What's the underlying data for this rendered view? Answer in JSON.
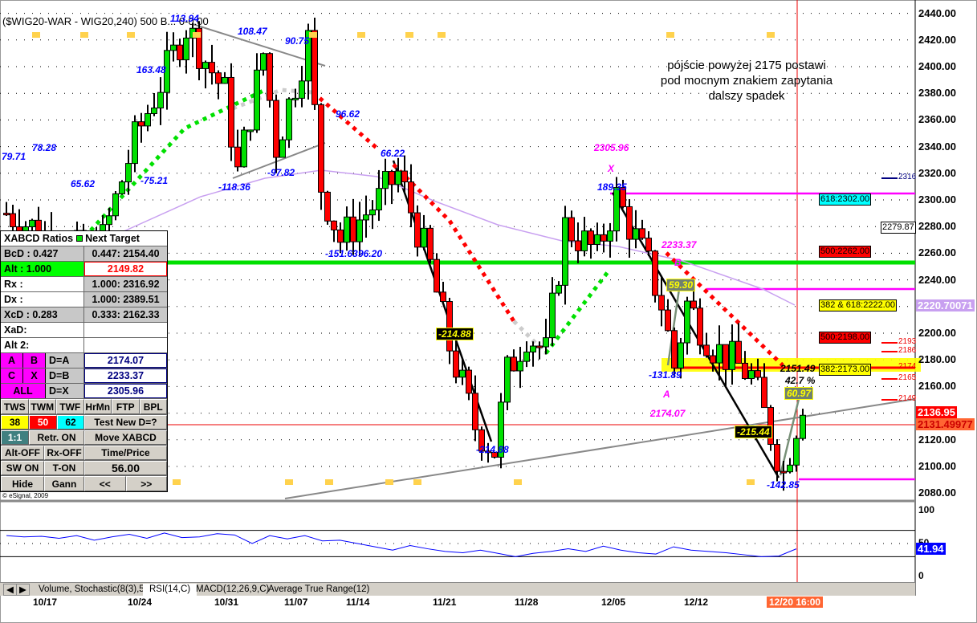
{
  "header": {
    "title": "($WIG20-WAR - WIG20,240) 500 B... 0-0:00",
    "copyright": "© eSignal, 2009"
  },
  "note": "pójście powyżej 2175 postawi pod mocnym znakiem zapytania dalszy spadek",
  "chart_data": {
    "type": "candlestick",
    "title": "($WIG20-WAR - WIG20,240)",
    "ylim": [
      2080,
      2440
    ],
    "y_ticks": [
      "2440.00",
      "2420.00",
      "2400.00",
      "2380.00",
      "2360.00",
      "2340.00",
      "2320.00",
      "2300.00",
      "2280.00",
      "2260.00",
      "2240.00",
      "2220.00",
      "2200.00",
      "2180.00",
      "2160.00",
      "2140.00",
      "2120.00",
      "2100.00",
      "2080.00"
    ],
    "x_ticks": [
      "10/17",
      "10/24",
      "10/31",
      "11/07",
      "11/14",
      "11/21",
      "11/28",
      "12/05",
      "12/12"
    ],
    "current_time": "12/20 16:00",
    "price_path": [
      [
        0,
        2290
      ],
      [
        14,
        2255
      ],
      [
        20,
        2345
      ],
      [
        28,
        2430
      ],
      [
        34,
        2380
      ],
      [
        36,
        2320
      ],
      [
        40,
        2410
      ],
      [
        42,
        2340
      ],
      [
        47,
        2420
      ],
      [
        49,
        2310
      ],
      [
        52,
        2270
      ],
      [
        58,
        2300
      ],
      [
        61,
        2320
      ],
      [
        66,
        2250
      ],
      [
        69,
        2190
      ],
      [
        73,
        2130
      ],
      [
        76,
        2112
      ],
      [
        78,
        2170
      ],
      [
        81,
        2200
      ],
      [
        84,
        2185
      ],
      [
        87,
        2280
      ],
      [
        92,
        2260
      ],
      [
        95,
        2302
      ],
      [
        100,
        2250
      ],
      [
        102,
        2222
      ],
      [
        104,
        2175
      ],
      [
        106,
        2222
      ],
      [
        110,
        2190
      ],
      [
        116,
        2168
      ],
      [
        121,
        2095
      ],
      [
        124,
        2150
      ]
    ],
    "annotations": [
      "79.71",
      "78.28",
      "65.62",
      "163.48",
      "-75.21",
      "113.94",
      "108.47",
      "-118.36",
      "90.75",
      "-97.82",
      "96.62",
      "-151.63",
      "96.20",
      "66.22",
      "-214.88",
      "-214.88",
      "2305.96",
      "X",
      "189.35",
      "2233.37",
      "B",
      "59.30",
      "-131.89",
      "A",
      "2174.07",
      "2151.49",
      "42.7 %",
      "60.97",
      "-215.44",
      "-142.85"
    ],
    "levels": {
      "fib": [
        "618:2302.00",
        "2279.87",
        "500:2262.00",
        "382 & 618:2222.00",
        "500:2198.00",
        "382:2173.00"
      ],
      "small": [
        "2316",
        "2193",
        "2186",
        "2174",
        "2165",
        "2149"
      ]
    },
    "badges": {
      "ma": "2220.70071",
      "last": "2136.95",
      "cursor": "2131.49977",
      "rsi": "41.94"
    },
    "rsi": {
      "name": "RSI(14,C)",
      "ticks": [
        "100",
        "50",
        "0"
      ],
      "values": [
        62,
        60,
        61,
        58,
        62,
        55,
        60,
        64,
        58,
        66,
        59,
        60,
        65,
        63,
        50,
        62,
        57,
        62,
        54,
        55,
        50,
        45,
        40,
        47,
        42,
        38,
        36,
        40,
        35,
        30,
        35,
        38,
        42,
        38,
        46,
        40,
        36,
        34,
        45,
        40,
        38,
        36,
        33,
        30,
        31,
        41.94
      ]
    },
    "colors": {
      "up": "#00e000",
      "down": "#ff0000",
      "ma": "#c8a0f0",
      "fib": "#ff00ff"
    }
  },
  "panel": {
    "header": "XABCD Ratios",
    "header2": "Next Target",
    "rows": [
      [
        "BcD :   0.427",
        "0.447: 2154.40"
      ],
      [
        "Alt  :   1.000",
        "2149.82"
      ],
      [
        "Rx  :",
        "1.000: 2316.92"
      ],
      [
        "Dx  :",
        "1.000: 2389.51"
      ],
      [
        "XcD :   0.283",
        "0.333: 2162.33"
      ],
      [
        "XaD:",
        ""
      ],
      [
        "Alt 2:",
        ""
      ]
    ],
    "targets": [
      [
        "A",
        "B",
        "D=A",
        "2174.07"
      ],
      [
        "C",
        "X",
        "D=B",
        "2233.37"
      ],
      [
        "ALL",
        "",
        "D=X",
        "2305.96"
      ]
    ],
    "buttons1": [
      "TWS",
      "TWM",
      "TWF",
      "HrMn",
      "FTP",
      "BPL"
    ],
    "ratios": [
      "38",
      "50",
      "62"
    ],
    "test": "Test New D=?",
    "b3": [
      "1:1",
      "Retr. ON",
      "Move XABCD"
    ],
    "b4": [
      "Alt-OFF",
      "Rx-OFF",
      "Time/Price"
    ],
    "b5": [
      "SW ON",
      "T-ON",
      "56.00"
    ],
    "b6": [
      "Hide",
      "Gann",
      "<<",
      ">>"
    ]
  },
  "tabs": [
    "Volume, Stochastic(8(3),5)",
    "RSI(14,C)",
    "MACD(12,26,9,C)",
    "Average True Range(12)"
  ]
}
